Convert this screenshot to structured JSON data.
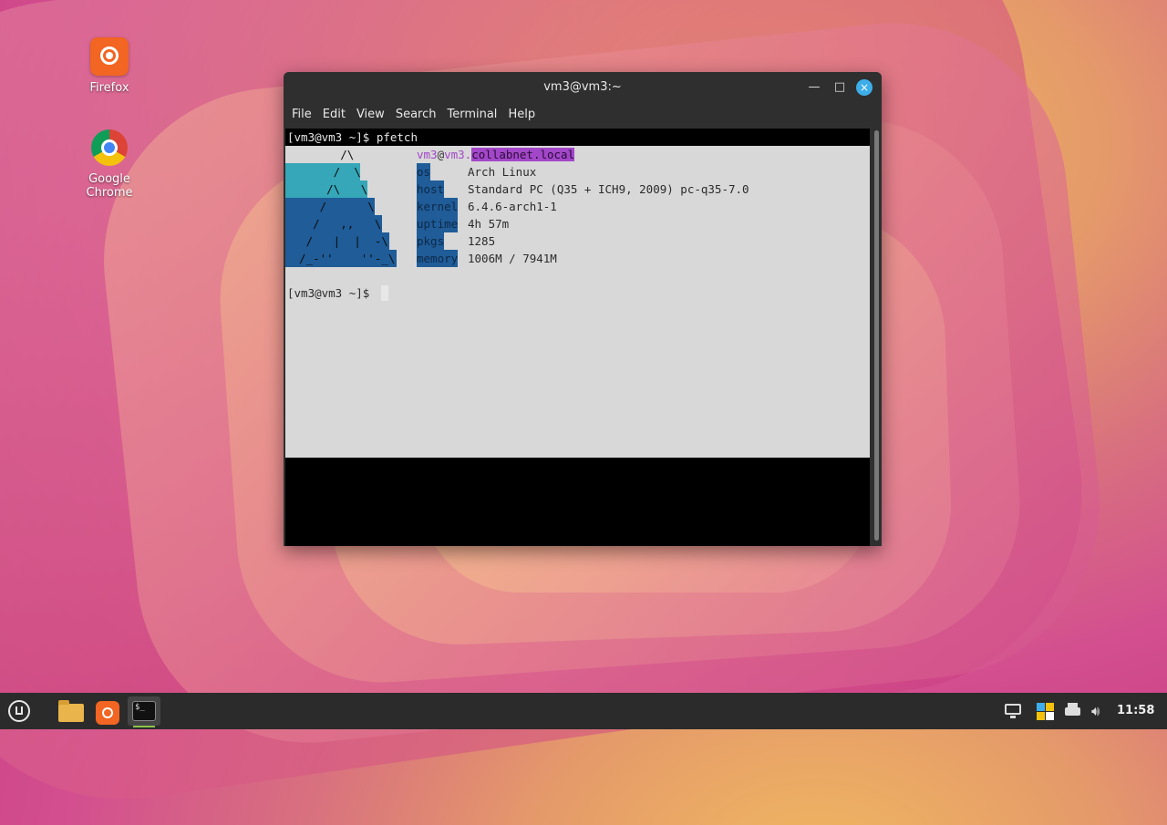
{
  "desktop": {
    "icons": [
      {
        "label": "Firefox"
      },
      {
        "label": "Google Chrome"
      }
    ]
  },
  "window": {
    "title": "vm3@vm3:~",
    "controls": {
      "minimize": "—",
      "maximize": "□",
      "close": "×"
    },
    "menu": [
      "File",
      "Edit",
      "View",
      "Search",
      "Terminal",
      "Help"
    ]
  },
  "terminal": {
    "prompt1": "[vm3@vm3 ~]$ pfetch",
    "prompt2": "[vm3@vm3 ~]$ ",
    "user": "vm3",
    "at": "@",
    "host": "vm3.",
    "domain": "collabnet.local",
    "ascii": [
      "        /\\",
      "       /  \\",
      "      /\\   \\",
      "     /      \\",
      "    /   ,,   \\",
      "   /   |  |  -\\",
      "  /_-''    ''-_\\"
    ],
    "info": [
      {
        "key": "os",
        "value": "Arch Linux"
      },
      {
        "key": "host",
        "value": "Standard PC (Q35 + ICH9, 2009) pc-q35-7.0"
      },
      {
        "key": "kernel",
        "value": "6.4.6-arch1-1"
      },
      {
        "key": "uptime",
        "value": "4h 57m"
      },
      {
        "key": "pkgs",
        "value": "1285"
      },
      {
        "key": "memory",
        "value": "1006M / 7941M"
      }
    ]
  },
  "taskbar": {
    "clock": "11:58",
    "terminal_icon_text": "$_"
  },
  "colors": {
    "selection_bg": "#d8d8d8",
    "key_bg": "#1f5c98",
    "ascii_teal": "#35a7b8",
    "ascii_blue": "#1f5c98",
    "host_highlight": "#a347c9"
  }
}
